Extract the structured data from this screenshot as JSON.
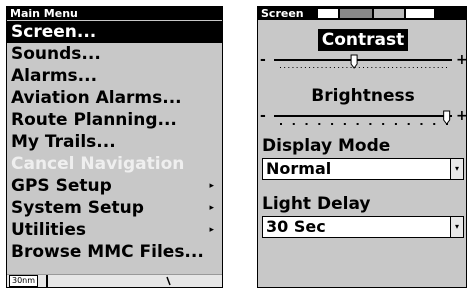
{
  "main_menu": {
    "title": "Main Menu",
    "items": [
      {
        "label": "Screen...",
        "selected": true
      },
      {
        "label": "Sounds..."
      },
      {
        "label": "Alarms..."
      },
      {
        "label": "Aviation Alarms..."
      },
      {
        "label": "Route Planning..."
      },
      {
        "label": "My Trails..."
      },
      {
        "label": "Cancel Navigation",
        "disabled": true
      },
      {
        "label": "GPS Setup",
        "submenu": true
      },
      {
        "label": "System Setup",
        "submenu": true
      },
      {
        "label": "Utilities",
        "submenu": true
      },
      {
        "label": "Browse MMC Files..."
      }
    ],
    "submenu_arrow": "▸",
    "map_scale": "30nm"
  },
  "screen_dialog": {
    "title": "Screen",
    "contrast": {
      "label": "Contrast",
      "level": 0.45
    },
    "brightness": {
      "label": "Brightness",
      "level": 0.97
    },
    "display_mode": {
      "label": "Display Mode",
      "value": "Normal"
    },
    "light_delay": {
      "label": "Light Delay",
      "value": "30 Sec"
    },
    "minus": "-",
    "plus": "+",
    "dropdown_arrow": "▾"
  },
  "colors": {
    "panel_bg": "#c8c8c8",
    "highlight_bg": "#000000",
    "highlight_text": "#ffffff",
    "disabled_text": "#efefef"
  }
}
